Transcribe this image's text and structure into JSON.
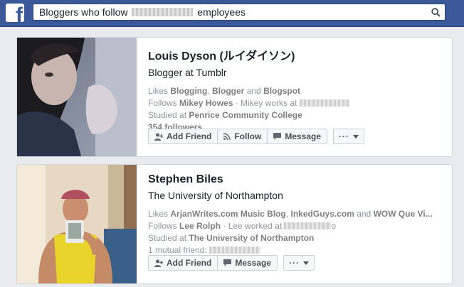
{
  "search": {
    "query_before": "Bloggers who follow ",
    "query_after": " employees"
  },
  "results": [
    {
      "name": "Louis Dyson (ルイダイソン)",
      "subtitle": "Blogger at Tumblr",
      "likes_prefix": "Likes ",
      "likes": [
        "Blogging",
        "Blogger",
        "Blogspot"
      ],
      "likes_sep": ", ",
      "likes_and": " and ",
      "follows_prefix": "Follows ",
      "follows": "Mikey Howes",
      "follows_suffix": " · Mikey works at ",
      "studied_prefix": "Studied at ",
      "studied": "Penrice Community College",
      "followers": "354 followers",
      "buttons": {
        "add_friend": "Add Friend",
        "follow": "Follow",
        "message": "Message"
      }
    },
    {
      "name": "Stephen Biles",
      "subtitle": "The University of Northampton",
      "likes_prefix": "Likes ",
      "likes": [
        "ArjanWrites.com Music Blog",
        "InkedGuys.com",
        "WOW Que Vi..."
      ],
      "likes_sep": ", ",
      "likes_and": " and ",
      "follows_prefix": "Follows ",
      "follows": "Lee Rolph",
      "follows_suffix": " · Lee worked at ",
      "follows_tail": "o",
      "studied_prefix": "Studied at ",
      "studied": "The University of Northampton",
      "mutual": "1 mutual friend: ",
      "buttons": {
        "add_friend": "Add Friend",
        "message": "Message"
      }
    }
  ],
  "colors": {
    "brand": "#3b5998",
    "background": "#e9ebee"
  },
  "icons": [
    "facebook-logo",
    "search-icon",
    "add-friend-icon",
    "rss-icon",
    "message-icon",
    "chevron-down-icon"
  ]
}
